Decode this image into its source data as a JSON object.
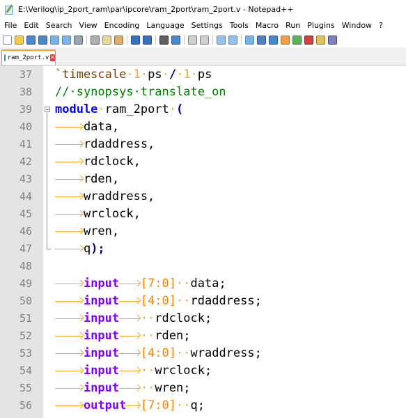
{
  "window": {
    "title": "E:\\Verilog\\ip_2port_ram\\par\\ipcore\\ram_2port\\ram_2port.v - Notepad++"
  },
  "menu": [
    "File",
    "Edit",
    "Search",
    "View",
    "Encoding",
    "Language",
    "Settings",
    "Tools",
    "Macro",
    "Run",
    "Plugins",
    "Window",
    "?"
  ],
  "tab": {
    "label": "ram_2port.v",
    "close": "✕"
  },
  "editor": {
    "lines": [
      {
        "n": "37",
        "t": [
          [
            "dir",
            "`timescale"
          ],
          [
            "dot",
            "·"
          ],
          [
            "num",
            "1"
          ],
          [
            "dot",
            "·"
          ],
          [
            "",
            "ps"
          ],
          [
            "dot",
            "·"
          ],
          [
            "op",
            "/"
          ],
          [
            "dot",
            "·"
          ],
          [
            "num",
            "1"
          ],
          [
            "dot",
            "·"
          ],
          [
            "",
            "ps"
          ]
        ]
      },
      {
        "n": "38",
        "t": [
          [
            "cmt",
            "//·synopsys·translate_on"
          ]
        ]
      },
      {
        "n": "39",
        "t": [
          [
            "kw",
            "module"
          ],
          [
            "dot",
            "·"
          ],
          [
            "",
            "ram_2port"
          ],
          [
            "dot",
            "·"
          ],
          [
            "op",
            "("
          ]
        ]
      },
      {
        "n": "40",
        "t": [
          [
            "TAB",
            ""
          ],
          [
            "",
            "data,"
          ]
        ]
      },
      {
        "n": "41",
        "t": [
          [
            "TAB",
            ""
          ],
          [
            "",
            "rdaddress,"
          ]
        ]
      },
      {
        "n": "42",
        "t": [
          [
            "TAB",
            ""
          ],
          [
            "",
            "rdclock,"
          ]
        ]
      },
      {
        "n": "43",
        "t": [
          [
            "TAB",
            ""
          ],
          [
            "",
            "rden,"
          ]
        ]
      },
      {
        "n": "44",
        "t": [
          [
            "TAB",
            ""
          ],
          [
            "",
            "wraddress,"
          ]
        ]
      },
      {
        "n": "45",
        "t": [
          [
            "TAB",
            ""
          ],
          [
            "",
            "wrclock,"
          ]
        ]
      },
      {
        "n": "46",
        "t": [
          [
            "TAB",
            ""
          ],
          [
            "",
            "wren,"
          ]
        ]
      },
      {
        "n": "47",
        "t": [
          [
            "TAB",
            ""
          ],
          [
            "",
            "q"
          ],
          [
            "op",
            ");"
          ]
        ]
      },
      {
        "n": "48",
        "t": []
      },
      {
        "n": "49",
        "t": [
          [
            "TAB",
            ""
          ],
          [
            "kw2",
            "input"
          ],
          [
            "TAB",
            ""
          ],
          [
            "rng",
            "[7:0]"
          ],
          [
            "dot",
            "··"
          ],
          [
            "",
            "data;"
          ]
        ]
      },
      {
        "n": "50",
        "t": [
          [
            "TAB",
            ""
          ],
          [
            "kw2",
            "input"
          ],
          [
            "TAB",
            ""
          ],
          [
            "rng",
            "[4:0]"
          ],
          [
            "dot",
            "··"
          ],
          [
            "",
            "rdaddress;"
          ]
        ]
      },
      {
        "n": "51",
        "t": [
          [
            "TAB",
            ""
          ],
          [
            "kw2",
            "input"
          ],
          [
            "TAB",
            ""
          ],
          [
            "dot",
            "··"
          ],
          [
            "",
            "rdclock;"
          ]
        ]
      },
      {
        "n": "52",
        "t": [
          [
            "TAB",
            ""
          ],
          [
            "kw2",
            "input"
          ],
          [
            "TAB",
            ""
          ],
          [
            "dot",
            "··"
          ],
          [
            "",
            "rden;"
          ]
        ]
      },
      {
        "n": "53",
        "t": [
          [
            "TAB",
            ""
          ],
          [
            "kw2",
            "input"
          ],
          [
            "TAB",
            ""
          ],
          [
            "rng",
            "[4:0]"
          ],
          [
            "dot",
            "··"
          ],
          [
            "",
            "wraddress;"
          ]
        ]
      },
      {
        "n": "54",
        "t": [
          [
            "TAB",
            ""
          ],
          [
            "kw2",
            "input"
          ],
          [
            "TAB",
            ""
          ],
          [
            "dot",
            "··"
          ],
          [
            "",
            "wrclock;"
          ]
        ]
      },
      {
        "n": "55",
        "t": [
          [
            "TAB",
            ""
          ],
          [
            "kw2",
            "input"
          ],
          [
            "TAB",
            ""
          ],
          [
            "dot",
            "··"
          ],
          [
            "",
            "wren;"
          ]
        ]
      },
      {
        "n": "56",
        "t": [
          [
            "TAB",
            ""
          ],
          [
            "kw2",
            "output"
          ],
          [
            "TAB",
            ""
          ],
          [
            "rng",
            "[7:0]"
          ],
          [
            "dot",
            "··"
          ],
          [
            "",
            "q;"
          ]
        ]
      }
    ]
  },
  "colors": {
    "whitespace": "#f5a623",
    "comment": "#008000",
    "keyword": "#0000ff",
    "type_keyword": "#8000ff",
    "gutter": "#e4e4e4"
  },
  "icons": {
    "app": "notepad-plus-plus-icon",
    "tab": "saved-file-icon",
    "tab_close": "close-icon"
  }
}
